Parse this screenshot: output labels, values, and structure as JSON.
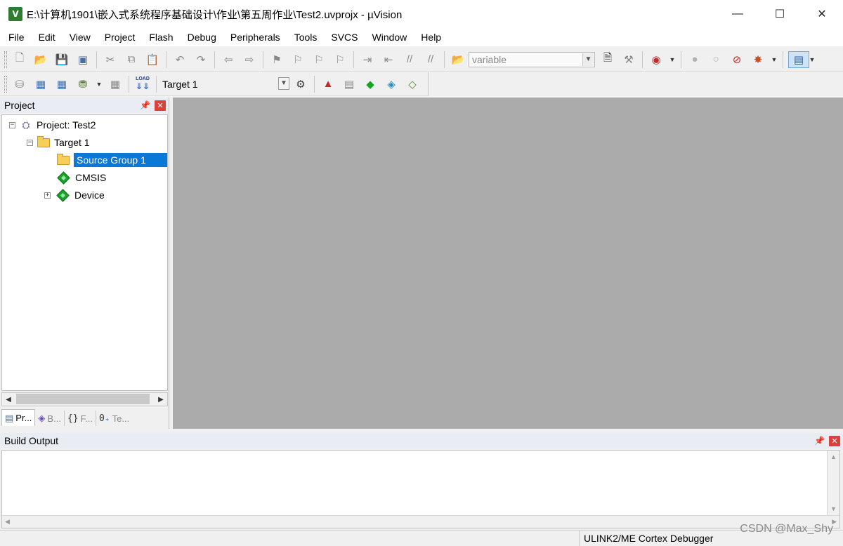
{
  "window": {
    "title": "E:\\计算机1901\\嵌入式系统程序基础设计\\作业\\第五周作业\\Test2.uvprojx - µVision",
    "app_icon_letter": "V",
    "controls": {
      "minimize": "—",
      "maximize": "☐",
      "close": "✕"
    }
  },
  "menu": [
    "File",
    "Edit",
    "View",
    "Project",
    "Flash",
    "Debug",
    "Peripherals",
    "Tools",
    "SVCS",
    "Window",
    "Help"
  ],
  "toolbar1": {
    "find_combo_value": "variable"
  },
  "toolbar2": {
    "target_combo_value": "Target 1",
    "load_label": "LOAD"
  },
  "project_panel": {
    "title": "Project",
    "tree": {
      "root": "Project: Test2",
      "target": "Target 1",
      "group": "Source Group 1",
      "cmsis": "CMSIS",
      "device": "Device"
    },
    "tabs": [
      "Pr...",
      "B...",
      "F...",
      "Te..."
    ]
  },
  "build_output": {
    "title": "Build Output"
  },
  "status": {
    "debugger": "ULINK2/ME Cortex Debugger"
  },
  "watermark": "CSDN @Max_Shy",
  "colors": {
    "selection": "#0a78d7",
    "editor_bg": "#ababab",
    "close_red": "#d9413a"
  }
}
